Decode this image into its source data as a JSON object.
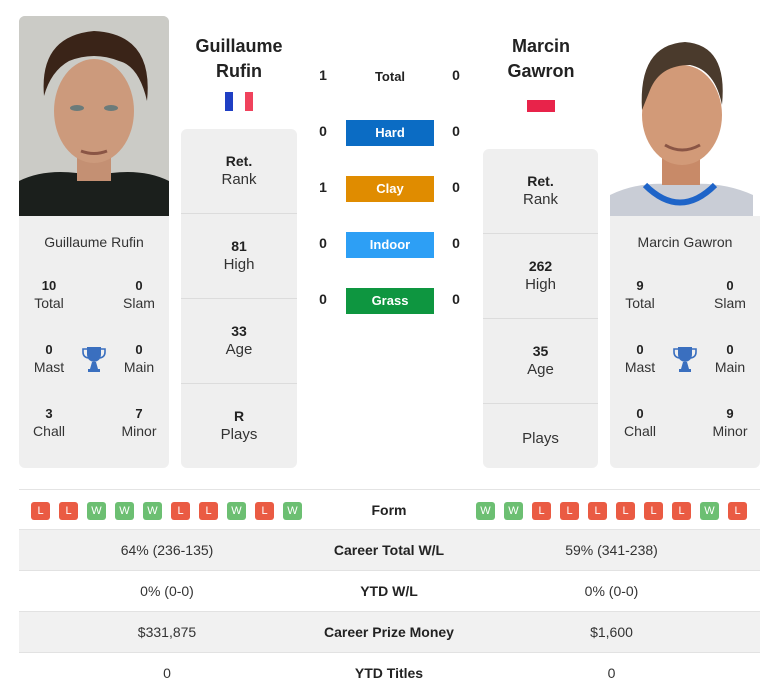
{
  "players": {
    "left": {
      "name_line1": "Guillaume",
      "name_line2": "Rufin",
      "full_name": "Guillaume Rufin",
      "country_flag": "flag-france",
      "titles": {
        "total": "10",
        "total_label": "Total",
        "slam": "0",
        "slam_label": "Slam",
        "mast": "0",
        "mast_label": "Mast",
        "main": "0",
        "main_label": "Main",
        "chall": "3",
        "chall_label": "Chall",
        "minor": "7",
        "minor_label": "Minor"
      },
      "info": [
        {
          "value": "Ret.",
          "label": "Rank"
        },
        {
          "value": "81",
          "label": "High"
        },
        {
          "value": "33",
          "label": "Age"
        },
        {
          "value": "R",
          "label": "Plays"
        }
      ],
      "form": [
        "L",
        "L",
        "W",
        "W",
        "W",
        "L",
        "L",
        "W",
        "L",
        "W"
      ]
    },
    "right": {
      "name_line1": "Marcin",
      "name_line2": "Gawron",
      "full_name": "Marcin Gawron",
      "country_flag": "flag-poland",
      "titles": {
        "total": "9",
        "total_label": "Total",
        "slam": "0",
        "slam_label": "Slam",
        "mast": "0",
        "mast_label": "Mast",
        "main": "0",
        "main_label": "Main",
        "chall": "0",
        "chall_label": "Chall",
        "minor": "9",
        "minor_label": "Minor"
      },
      "info": [
        {
          "value": "Ret.",
          "label": "Rank"
        },
        {
          "value": "262",
          "label": "High"
        },
        {
          "value": "35",
          "label": "Age"
        },
        {
          "value": "",
          "label": "Plays"
        }
      ],
      "form": [
        "W",
        "W",
        "L",
        "L",
        "L",
        "L",
        "L",
        "L",
        "W",
        "L"
      ]
    }
  },
  "h2h": {
    "total": {
      "label": "Total",
      "left": "1",
      "right": "0"
    },
    "surfaces": [
      {
        "label": "Hard",
        "left": "0",
        "right": "0",
        "color": "#0b6cc4"
      },
      {
        "label": "Clay",
        "left": "1",
        "right": "0",
        "color": "#e08c00"
      },
      {
        "label": "Indoor",
        "left": "0",
        "right": "0",
        "color": "#2d9ff5"
      },
      {
        "label": "Grass",
        "left": "0",
        "right": "0",
        "color": "#0e9640"
      }
    ]
  },
  "form_label": "Form",
  "stats": [
    {
      "label": "Career Total W/L",
      "left": "64% (236-135)",
      "right": "59% (341-238)"
    },
    {
      "label": "YTD W/L",
      "left": "0% (0-0)",
      "right": "0% (0-0)"
    },
    {
      "label": "Career Prize Money",
      "left": "$331,875",
      "right": "$1,600"
    },
    {
      "label": "YTD Titles",
      "left": "0",
      "right": "0"
    }
  ],
  "colors": {
    "win": "#6cbf72",
    "loss": "#ea5b43",
    "trophy": "#3a6fbf",
    "card_bg": "#efefef"
  }
}
